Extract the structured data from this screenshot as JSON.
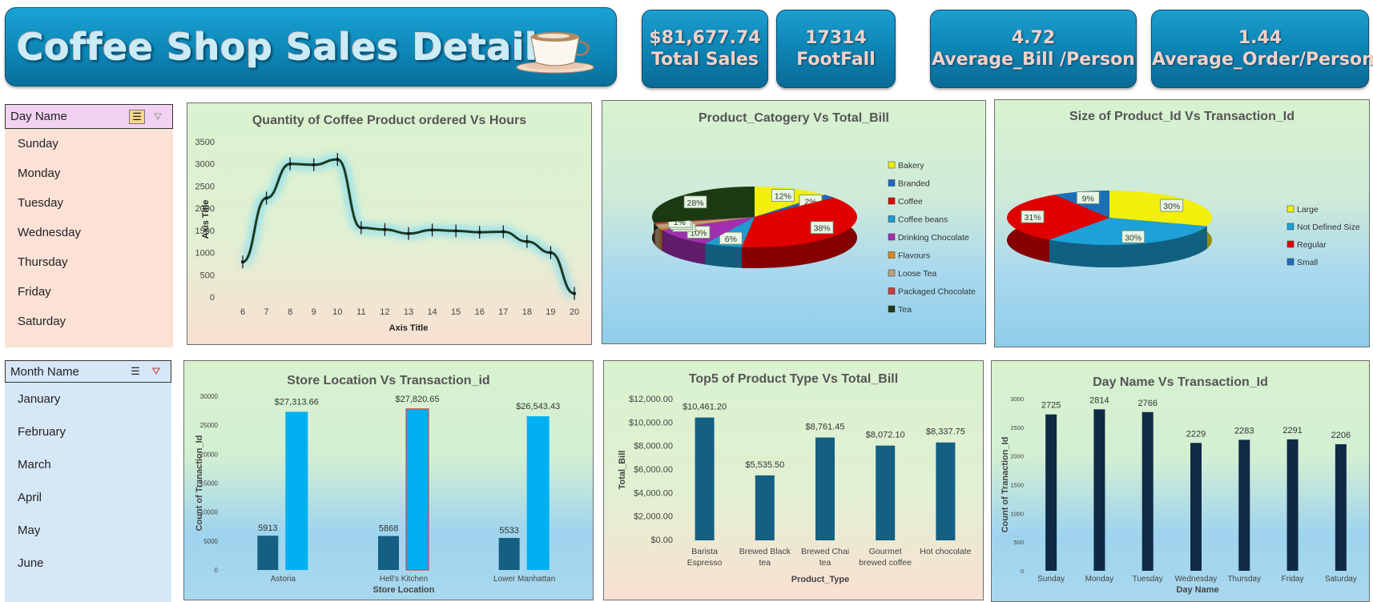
{
  "header": {
    "title": "Coffee Shop Sales Details"
  },
  "kpis": [
    {
      "value": "$81,677.74",
      "label": "Total Sales"
    },
    {
      "value": "17314",
      "label": "FootFall"
    },
    {
      "value": "4.72",
      "label": "Average_Bill /Person"
    },
    {
      "value": "1.44",
      "label": "Average_Order/Person"
    }
  ],
  "day_slicer": {
    "header": "Day Name",
    "items": [
      "Sunday",
      "Monday",
      "Tuesday",
      "Wednesday",
      "Thursday",
      "Friday",
      "Saturday"
    ]
  },
  "month_slicer": {
    "header": "Month Name",
    "items": [
      "January",
      "February",
      "March",
      "April",
      "May",
      "June"
    ]
  },
  "colors": {
    "accent": "#0d87b8",
    "bar_dark": "#145f82",
    "bar_light": "#00b0f0",
    "bar_navy": "#0f2a45",
    "line": "#1d3a1d"
  },
  "chart_data": [
    {
      "type": "line",
      "title": "Quantity of Coffee Product ordered Vs Hours",
      "xlabel": "Axis Title",
      "ylabel": "Axis Title",
      "x": [
        6,
        7,
        8,
        9,
        10,
        11,
        12,
        13,
        14,
        15,
        16,
        17,
        18,
        19,
        20
      ],
      "values": [
        790,
        2230,
        3000,
        2980,
        3100,
        1560,
        1520,
        1430,
        1510,
        1490,
        1460,
        1470,
        1250,
        1000,
        80
      ],
      "ylim": [
        0,
        3500
      ],
      "yticks": [
        "0",
        "500",
        "1000",
        "1500",
        "2000",
        "2500",
        "3000",
        "3500"
      ]
    },
    {
      "type": "pie",
      "title": "Product_Catogery Vs Total_Bill",
      "labels": [
        "Bakery",
        "Branded",
        "Coffee",
        "Coffee beans",
        "Drinking Chocolate",
        "Flavours",
        "Loose Tea",
        "Packaged Chocolate",
        "Tea"
      ],
      "values": [
        12,
        2,
        38,
        6,
        10,
        1,
        2,
        1,
        28
      ],
      "data_labels": [
        "12%",
        "2%",
        "38%",
        "6%",
        "10%",
        "1%",
        "2%",
        "1%",
        "28%"
      ],
      "colors": [
        "#f2ef0c",
        "#1e67c0",
        "#e00000",
        "#1e9bd0",
        "#a22fb0",
        "#d68a2a",
        "#c0a080",
        "#c04040",
        "#1b3a12"
      ],
      "legend": "right"
    },
    {
      "type": "pie",
      "title": "Size of Product_Id Vs Transaction_Id",
      "labels": [
        "Large",
        "Not Defined Size",
        "Regular",
        "Small"
      ],
      "values": [
        30,
        30,
        31,
        9
      ],
      "data_labels": [
        "30%",
        "30%",
        "31%",
        "9%"
      ],
      "colors": [
        "#f2ef0c",
        "#1ea0d8",
        "#e00000",
        "#1a6fb8"
      ],
      "legend": "right"
    },
    {
      "type": "bar",
      "title": "Store Location Vs Transaction_id",
      "xlabel": "Store Location",
      "ylabel": "Count of Tranaction_Id",
      "categories": [
        "Astoria",
        "Hell's Kitchen",
        "Lower Manhattan"
      ],
      "series": [
        {
          "values": [
            5913,
            5868,
            5533
          ],
          "data_labels": [
            "5913",
            "5868",
            "5533"
          ]
        },
        {
          "values": [
            27313.66,
            27820.65,
            26543.43
          ],
          "data_labels": [
            "$27,313.66",
            "$27,820.65",
            "$26,543.43"
          ]
        }
      ],
      "ylim": [
        0,
        30000
      ],
      "yticks": [
        "0",
        "5000",
        "10000",
        "15000",
        "20000",
        "25000",
        "30000"
      ]
    },
    {
      "type": "bar",
      "title": "Top5 of Product Type  Vs Total_Bill",
      "xlabel": "Product_Type",
      "ylabel": "Total_Bill",
      "categories": [
        [
          "Barista",
          "Espresso"
        ],
        [
          "Brewed Black",
          "tea"
        ],
        [
          "Brewed Chai",
          "tea"
        ],
        [
          "Gourmet",
          "brewed coffee"
        ],
        [
          "Hot chocolate"
        ]
      ],
      "values": [
        10461.2,
        5535.5,
        8761.45,
        8072.1,
        8337.75
      ],
      "data_labels": [
        "$10,461.20",
        "$5,535.50",
        "$8,761.45",
        "$8,072.10",
        "$8,337.75"
      ],
      "ylim": [
        0,
        12000
      ],
      "yticks": [
        "$0.00",
        "$2,000.00",
        "$4,000.00",
        "$6,000.00",
        "$8,000.00",
        "$10,000.00",
        "$12,000.00"
      ]
    },
    {
      "type": "bar",
      "title": "Day Name Vs Transaction_Id",
      "xlabel": "Day Name",
      "ylabel": "Count of Tranaction_Id",
      "categories": [
        "Sunday",
        "Monday",
        "Tuesday",
        "Wednesday",
        "Thursday",
        "Friday",
        "Saturday"
      ],
      "values": [
        2725,
        2814,
        2766,
        2229,
        2283,
        2291,
        2206
      ],
      "data_labels": [
        "2725",
        "2814",
        "2766",
        "2229",
        "2283",
        "2291",
        "2206"
      ],
      "ylim": [
        0,
        3000
      ],
      "yticks": [
        "0",
        "500",
        "1000",
        "1500",
        "2000",
        "2500",
        "3000"
      ]
    }
  ]
}
